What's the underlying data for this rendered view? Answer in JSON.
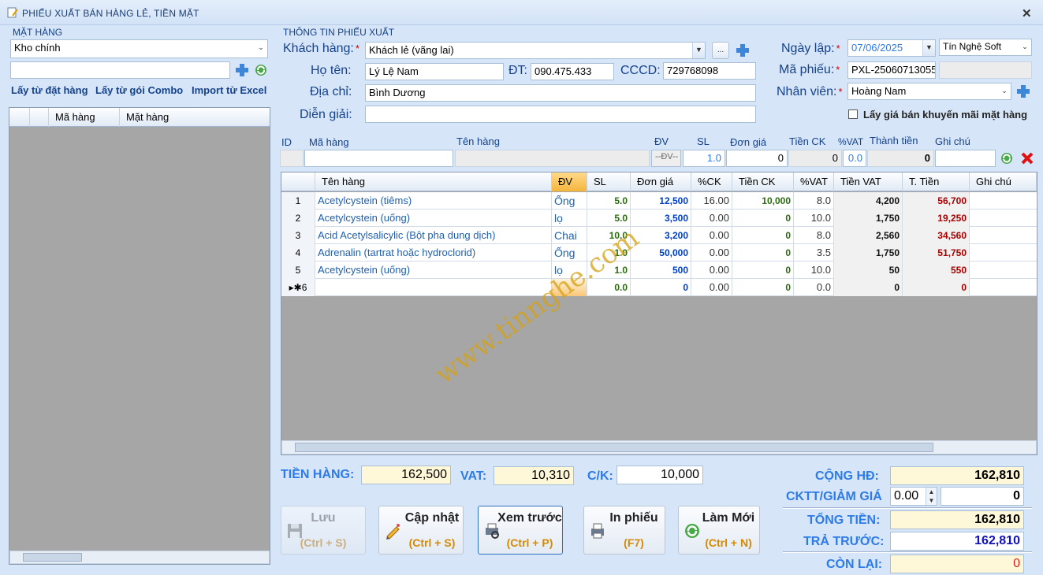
{
  "title": "PHIẾU XUẤT BÁN HÀNG LẺ, TIỀN MẶT",
  "left": {
    "group_label": "MẶT HÀNG",
    "warehouse": "Kho chính",
    "links": [
      "Lấy từ đặt hàng",
      "Lấy từ gói Combo",
      "Import từ Excel"
    ],
    "cols": [
      "Mã hàng",
      "Mặt hàng"
    ]
  },
  "info": {
    "group_label": "THÔNG TIN PHIẾU XUẤT",
    "customer_label": "Khách hàng:",
    "customer": "Khách lẻ (vãng lai)",
    "name_label": "Họ tên:",
    "name": "Lý Lệ Nam",
    "phone_label": "ĐT:",
    "phone": "090.475.433",
    "cccd_label": "CCCD:",
    "cccd": "729768098",
    "address_label": "Địa chỉ:",
    "address": "Bình Dương",
    "desc_label": "Diễn giải:",
    "desc": "",
    "date_label": "Ngày lập:",
    "date": "07/06/2025",
    "company": "Tín Nghệ Soft",
    "code_label": "Mã phiếu:",
    "code": "PXL-25060713055",
    "staff_label": "Nhân viên:",
    "staff": "Hoàng Nam",
    "promo_label": "Lấy giá bán khuyến mãi mặt hàng",
    "ellipsis": "..."
  },
  "entry": {
    "labels": [
      "ID",
      "Mã hàng",
      "Tên hàng",
      "ĐV",
      "SL",
      "Đơn giá",
      "Tiền CK",
      "%VAT",
      "Thành tiền",
      "Ghi chú"
    ],
    "dv": "--ĐV--",
    "sl": "1.0",
    "price": "0",
    "ck": "0",
    "vat": "0.0",
    "total": "0"
  },
  "grid": {
    "cols": [
      "Tên hàng",
      "ĐV",
      "SL",
      "Đơn giá",
      "%CK",
      "Tiền CK",
      "%VAT",
      "Tiền VAT",
      "T. Tiền",
      "Ghi chú"
    ],
    "rows": [
      {
        "no": "1",
        "name": "Acetylcystein (tiêms)",
        "dv": "Ống",
        "sl": "5.0",
        "price": "12,500",
        "ck": "16.00",
        "tck": "10,000",
        "vat": "8.0",
        "tvat": "4,200",
        "tt": "56,700"
      },
      {
        "no": "2",
        "name": "Acetylcystein (uống)",
        "dv": "lọ",
        "sl": "5.0",
        "price": "3,500",
        "ck": "0.00",
        "tck": "0",
        "vat": "10.0",
        "tvat": "1,750",
        "tt": "19,250"
      },
      {
        "no": "3",
        "name": "Acid Acetylsalicylic (Bột pha dung dịch)",
        "dv": "Chai",
        "sl": "10.0",
        "price": "3,200",
        "ck": "0.00",
        "tck": "0",
        "vat": "8.0",
        "tvat": "2,560",
        "tt": "34,560"
      },
      {
        "no": "4",
        "name": "Adrenalin (tartrat hoặc hydroclorid)",
        "dv": "Ống",
        "sl": "1.0",
        "price": "50,000",
        "ck": "0.00",
        "tck": "0",
        "vat": "3.5",
        "tvat": "1,750",
        "tt": "51,750"
      },
      {
        "no": "5",
        "name": "Acetylcystein (uống)",
        "dv": "lọ",
        "sl": "1.0",
        "price": "500",
        "ck": "0.00",
        "tck": "0",
        "vat": "10.0",
        "tvat": "50",
        "tt": "550"
      },
      {
        "no": "▸✱6",
        "name": "",
        "dv": "",
        "sl": "0.0",
        "price": "0",
        "ck": "0.00",
        "tck": "0",
        "vat": "0.0",
        "tvat": "0",
        "tt": "0"
      }
    ],
    "watermark": "www.tinnghe.com"
  },
  "totals": {
    "goods_label": "TIỀN HÀNG:",
    "goods": "162,500",
    "vat_label": "VAT:",
    "vat": "10,310",
    "ck_label": "C/K:",
    "ck": "10,000",
    "sum_label": "CỘNG HĐ:",
    "sum": "162,810",
    "disc_label": "CKTT/GIẢM GIÁ",
    "disc_pct": "0.00",
    "disc": "0",
    "total_label": "TỔNG TIỀN:",
    "total": "162,810",
    "paid_label": "TRẢ TRƯỚC:",
    "paid": "162,810",
    "remain_label": "CÒN LẠI:",
    "remain": "0"
  },
  "buttons": [
    {
      "t1": "Lưu",
      "t2": "(Ctrl + S)"
    },
    {
      "t1": "Cập nhật",
      "t2": "(Ctrl + S)"
    },
    {
      "t1": "Xem trước",
      "t2": "(Ctrl + P)"
    },
    {
      "t1": "In phiếu",
      "t2": "(F7)"
    },
    {
      "t1": "Làm Mới",
      "t2": "(Ctrl + N)"
    }
  ],
  "colors": {
    "accent": "#15428b",
    "total_blue": "#2d7be8",
    "price_blue": "#0040c0",
    "tt_red": "#a80000"
  }
}
